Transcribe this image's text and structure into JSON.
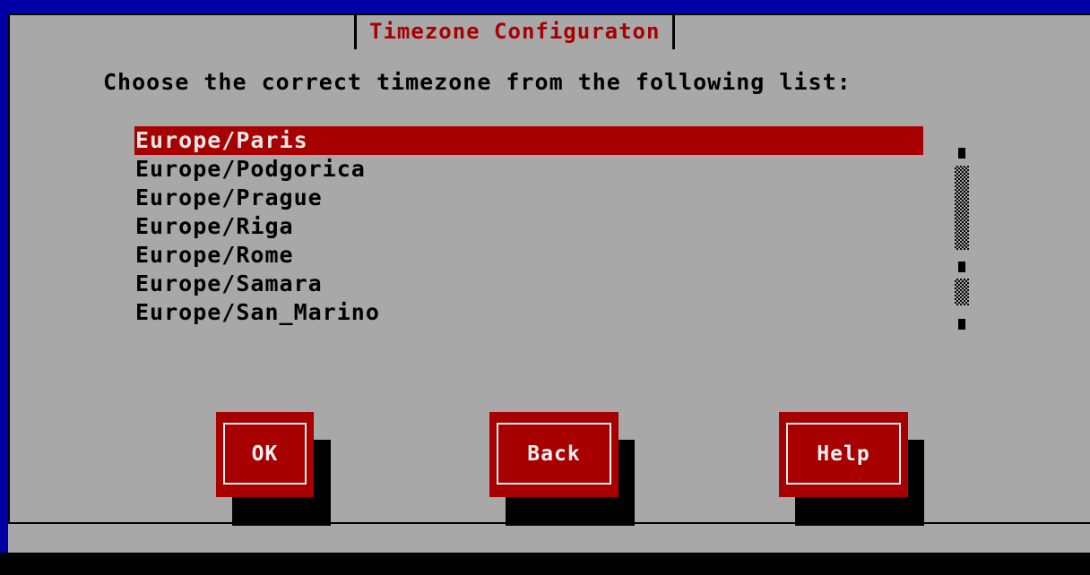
{
  "dialog": {
    "title": "Timezone Configuraton",
    "prompt": "Choose the correct timezone from the following list:"
  },
  "timezones": {
    "selected_index": 0,
    "items": [
      "Europe/Paris",
      "Europe/Podgorica",
      "Europe/Prague",
      "Europe/Riga",
      "Europe/Rome",
      "Europe/Samara",
      "Europe/San_Marino"
    ]
  },
  "buttons": {
    "ok": "OK",
    "back": "Back",
    "help": "Help"
  },
  "colors": {
    "background": "#0000a8",
    "dialog": "#a8a8a8",
    "accent": "#a80000",
    "text": "#000000",
    "highlight_text": "#f2f2f2"
  }
}
